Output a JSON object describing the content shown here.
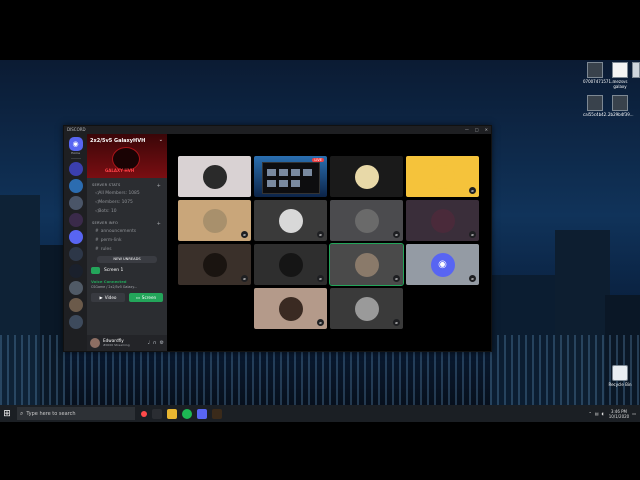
{
  "window": {
    "title": "DISCORD"
  },
  "guilds": {
    "home_label": "Home"
  },
  "server": {
    "name": "2x2/5v5 GalaxyHVH",
    "banner_text": "GALAXY HVH",
    "categories": {
      "stats": "SERVER STATS",
      "info": "SERVER INFO"
    },
    "stats": [
      {
        "label": "All Members: 1085"
      },
      {
        "label": "Members: 1075"
      },
      {
        "label": "Bots: 10"
      }
    ],
    "channels": [
      {
        "label": "announcements"
      },
      {
        "label": "perm-link"
      },
      {
        "label": "rules"
      },
      {
        "label": "faq"
      }
    ],
    "new_unreads": "NEW UNREADS"
  },
  "voice": {
    "channel": "Screen 1",
    "status": "Voice Connected",
    "sub": "CSGame / 2x2/5v5 Galaxy...",
    "video_label": "Video",
    "screen_label": "Screen"
  },
  "user": {
    "name": "Edwardfly",
    "tag": "#0000 Streaming"
  },
  "stage": {
    "live_label": "LIVE"
  },
  "taskbar": {
    "search_placeholder": "Type here to search",
    "time": "3:46 PM",
    "date": "10/1/2020"
  },
  "desktop_icons": [
    {
      "label": "07007471571..."
    },
    {
      "label": "mezsvs galaxy"
    },
    {
      "label": "cbf..."
    },
    {
      "label": "cal55c4b42..."
    },
    {
      "label": "2b29b4f39..."
    }
  ],
  "recycle_bin": "Recycle Bin",
  "colors": {
    "discord_blurple": "#5865f2",
    "voice_green": "#23a55a",
    "live_red": "#ed4245"
  }
}
